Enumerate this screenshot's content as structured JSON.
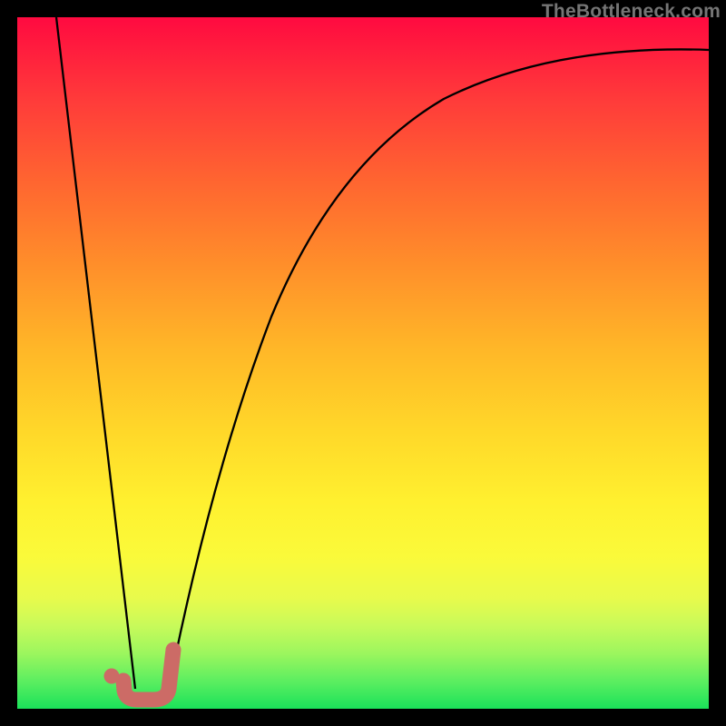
{
  "watermark": "TheBottleneck.com",
  "chart_data": {
    "type": "line",
    "title": "",
    "xlabel": "",
    "ylabel": "",
    "xlim": [
      0,
      100
    ],
    "ylim": [
      0,
      100
    ],
    "background": {
      "style": "vertical-gradient",
      "meaning": "red = high bottleneck, green = low bottleneck",
      "stops": [
        {
          "pos": 0,
          "color": "#ff0a40"
        },
        {
          "pos": 50,
          "color": "#ffb728"
        },
        {
          "pos": 80,
          "color": "#fafa3a"
        },
        {
          "pos": 100,
          "color": "#1ae25a"
        }
      ]
    },
    "series": [
      {
        "name": "curve-left",
        "x": [
          5.6,
          17.1
        ],
        "y": [
          100,
          2.9
        ]
      },
      {
        "name": "curve-right",
        "x": [
          21.9,
          28.2,
          36.7,
          45.9,
          61.7,
          77.4,
          100
        ],
        "y": [
          2.9,
          34.4,
          56.7,
          79.0,
          88.2,
          96.1,
          95.3
        ]
      }
    ],
    "annotations": [
      {
        "name": "j-marker",
        "shape": "J",
        "color": "#cc6b66",
        "dot": {
          "x": 13.6,
          "y": 4.7
        },
        "path_x": [
          22.6,
          21.9,
          19.7,
          17.3,
          15.5,
          15.4
        ],
        "path_y": [
          8.5,
          2.9,
          1.3,
          1.3,
          2.6,
          4.1
        ]
      }
    ]
  }
}
